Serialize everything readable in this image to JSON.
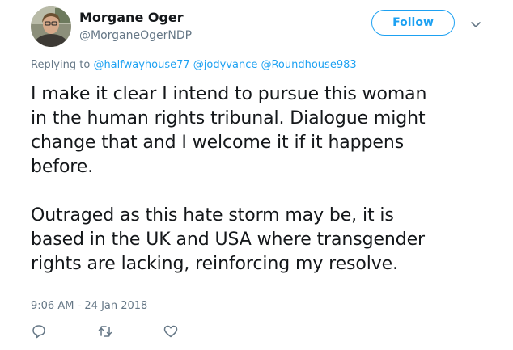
{
  "author": {
    "display_name": "Morgane Oger",
    "handle": "@MorganeOgerNDP",
    "avatar_icon": "profile-photo"
  },
  "follow_button": {
    "label": "Follow",
    "color": "#1da1f2"
  },
  "more_menu": {
    "icon": "chevron-down-icon"
  },
  "reply_context": {
    "prefix": "Replying to",
    "mentions": [
      "@halfwayhouse77",
      "@jodyvance",
      "@Roundhouse983"
    ]
  },
  "tweet": {
    "paragraphs": [
      {
        "lines": [
          "I make it clear I intend to pursue this woman",
          "in the human rights tribunal. Dialogue might",
          "change that and I welcome it if it happens",
          "before."
        ]
      },
      {
        "lines": [
          "Outraged as this hate storm may be, it is",
          "based in the UK and USA where transgender",
          "rights are lacking, reinforcing my resolve."
        ]
      }
    ],
    "timestamp": "9:06 AM - 24 Jan 2018"
  },
  "actions": [
    {
      "name": "reply",
      "icon": "speech-bubble-icon"
    },
    {
      "name": "retweet",
      "icon": "retweet-icon"
    },
    {
      "name": "like",
      "icon": "heart-icon"
    }
  ],
  "colors": {
    "text": "#14171a",
    "secondary": "#657786",
    "link": "#1da1f2"
  }
}
